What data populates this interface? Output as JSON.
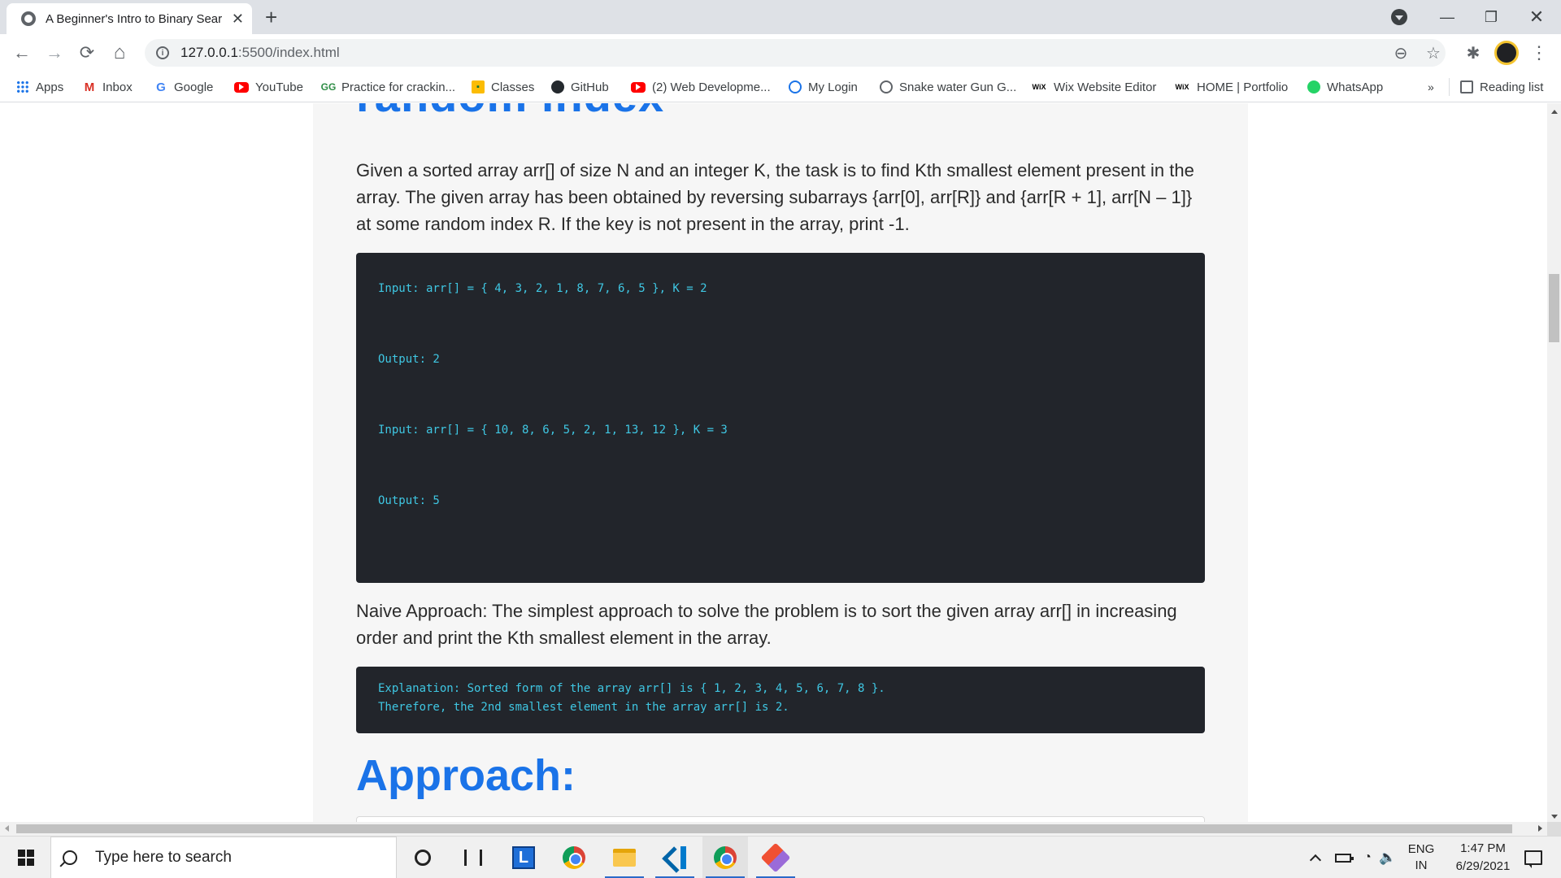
{
  "browser": {
    "tab": {
      "title": "A Beginner's Intro to Binary Sear",
      "close": "✕"
    },
    "new_tab": "+",
    "window": {
      "minimize": "—",
      "restore": "❐",
      "close": "✕"
    },
    "toolbar": {
      "back": "←",
      "forward": "→",
      "reload": "⟳",
      "home": "⌂",
      "zoom": "⊖",
      "star": "☆",
      "extensions": "✱",
      "menu": "⋮"
    },
    "url": {
      "host": "127.0.0.1",
      "path": ":5500/index.html"
    },
    "bookmarks": [
      {
        "label": "Apps",
        "icon": "apps-grid-icon"
      },
      {
        "label": "Inbox",
        "icon": "gmail-icon",
        "glyph": "M"
      },
      {
        "label": "Google",
        "icon": "google-icon",
        "glyph": "G"
      },
      {
        "label": "YouTube",
        "icon": "youtube-icon"
      },
      {
        "label": "Practice for crackin...",
        "icon": "gfg-icon",
        "glyph": "GG"
      },
      {
        "label": "Classes",
        "icon": "classroom-icon",
        "glyph": "▪"
      },
      {
        "label": "GitHub",
        "icon": "github-icon"
      },
      {
        "label": "(2) Web Developme...",
        "icon": "youtube-icon"
      },
      {
        "label": "My Login",
        "icon": "login-icon"
      },
      {
        "label": "Snake water Gun G...",
        "icon": "globe-icon"
      },
      {
        "label": "Wix Website Editor",
        "icon": "wix-icon",
        "glyph": "WiX"
      },
      {
        "label": "HOME | Portfolio",
        "icon": "wix-icon",
        "glyph": "WiX"
      },
      {
        "label": "WhatsApp",
        "icon": "whatsapp-icon"
      }
    ],
    "bookmarks_overflow": "»",
    "reading_list": "Reading list"
  },
  "page": {
    "heading_cut": "random index",
    "paragraph1": "Given a sorted array arr[] of size N and an integer K, the task is to find Kth smallest element present in the array. The given array has been obtained by reversing subarrays {arr[0], arr[R]} and {arr[R + 1], arr[N – 1]} at some random index R. If the key is not present in the array, print -1.",
    "example_lines": [
      "Input: arr[] = { 4, 3, 2, 1, 8, 7, 6, 5 }, K = 2",
      "Output: 2",
      "Input: arr[] = { 10, 8, 6, 5, 2, 1, 13, 12 }, K = 3",
      "Output: 5"
    ],
    "paragraph2": "Naive Approach: The simplest approach to solve the problem is to sort the given array arr[] in increasing order and print the Kth smallest element in the array.",
    "explanation_lines": [
      "Explanation: Sorted form of the array arr[] is { 1, 2, 3, 4, 5, 6, 7, 8 }.",
      "Therefore, the 2nd smallest element in the array arr[] is 2."
    ],
    "heading2": "Approach:",
    "colors": {
      "heading": "#1a73e8",
      "code_bg": "#22252b",
      "code_text": "#3fc7e3"
    }
  },
  "taskbar": {
    "search_placeholder": "Type here to search",
    "apps": [
      "cortana-icon",
      "task-view-icon",
      "l-app-icon",
      "chrome-icon",
      "file-explorer-icon",
      "vscode-icon",
      "chrome-icon",
      "gitkraken-icon"
    ],
    "language": {
      "line1": "ENG",
      "line2": "IN"
    },
    "time": "1:47 PM",
    "date": "6/29/2021"
  }
}
